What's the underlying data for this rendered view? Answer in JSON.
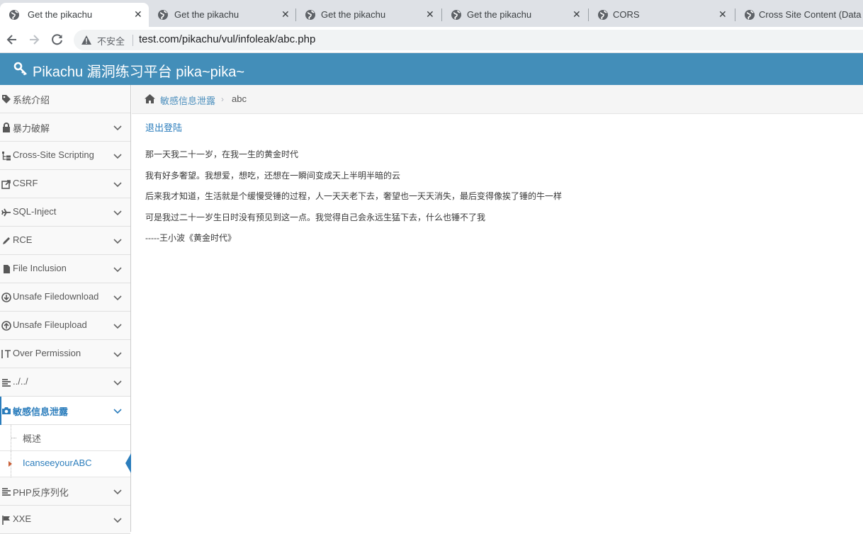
{
  "browser": {
    "tabs": [
      {
        "title": "Get the pikachu"
      },
      {
        "title": "Get the pikachu"
      },
      {
        "title": "Get the pikachu"
      },
      {
        "title": "Get the pikachu"
      },
      {
        "title": "CORS"
      },
      {
        "title": "Cross Site Content (Data"
      }
    ],
    "close_glyph": "✕",
    "insecure_label": "不安全",
    "url": "test.com/pikachu/vul/infoleak/abc.php"
  },
  "app": {
    "title": "Pikachu 漏洞练习平台 pika~pika~"
  },
  "sidebar": {
    "items": [
      {
        "label": "系统介绍",
        "icon": "tags-icon"
      },
      {
        "label": "暴力破解",
        "icon": "lock-icon"
      },
      {
        "label": "Cross-Site Scripting",
        "icon": "sitemap-icon"
      },
      {
        "label": "CSRF",
        "icon": "share-icon"
      },
      {
        "label": "SQL-Inject",
        "icon": "plane-icon"
      },
      {
        "label": "RCE",
        "icon": "pencil-icon"
      },
      {
        "label": "File Inclusion",
        "icon": "file-icon"
      },
      {
        "label": "Unsafe Filedownload",
        "icon": "download-icon"
      },
      {
        "label": "Unsafe Fileupload",
        "icon": "upload-icon"
      },
      {
        "label": "Over Permission",
        "icon": "text-height-icon"
      },
      {
        "label": "../../",
        "icon": "align-left-icon"
      },
      {
        "label": "敏感信息泄露",
        "icon": "camera-icon",
        "active": true
      },
      {
        "label": "PHP反序列化",
        "icon": "align-left-icon"
      },
      {
        "label": "XXE",
        "icon": "flag-icon"
      }
    ],
    "sub_items": [
      {
        "label": "概述"
      },
      {
        "label": "IcanseeyourABC",
        "active": true
      }
    ]
  },
  "breadcrumb": {
    "section": "敏感信息泄露",
    "separator": "›",
    "current": "abc"
  },
  "content": {
    "logout": "退出登陆",
    "lines": [
      "那一天我二十一岁，在我一生的黄金时代",
      "我有好多奢望。我想爱，想吃，还想在一瞬间变成天上半明半暗的云",
      "后来我才知道，生活就是个缓慢受锤的过程，人一天天老下去，奢望也一天天消失，最后变得像挨了锤的牛一样",
      "可是我过二十一岁生日时没有预见到这一点。我觉得自己会永远生猛下去，什么也锤不了我",
      "-----王小波《黄金时代》"
    ]
  },
  "colors": {
    "header_bg": "#438eb9",
    "accent": "#2b7dbc",
    "link": "#4c8fbd"
  }
}
